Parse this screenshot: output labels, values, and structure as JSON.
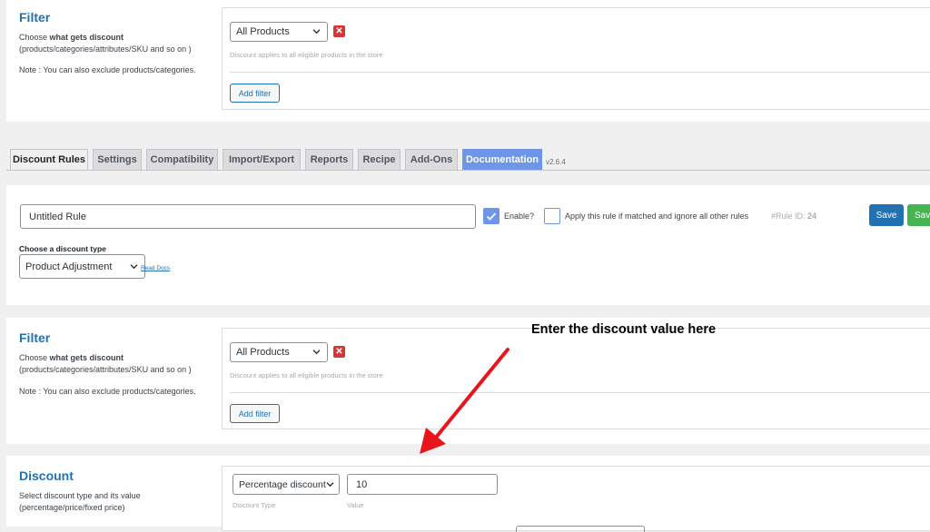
{
  "filter_top": {
    "title": "Filter",
    "desc_prefix": "Choose ",
    "desc_bold": "what gets discount",
    "desc_line2": "(products/categories/attributes/SKU and so on )",
    "note": "Note : You can also exclude products/categories.",
    "select_value": "All Products",
    "hint": "Discount applies to all eligible products in the store",
    "add_filter": "Add filter"
  },
  "tabs": [
    {
      "label": "Discount Rules"
    },
    {
      "label": "Settings"
    },
    {
      "label": "Compatibility"
    },
    {
      "label": "Import/Export"
    },
    {
      "label": "Reports"
    },
    {
      "label": "Recipe"
    },
    {
      "label": "Add-Ons"
    },
    {
      "label": "Documentation"
    }
  ],
  "version": "v2.6.4",
  "rule": {
    "name_value": "Untitled Rule",
    "enable_label": "Enable?",
    "apply_label": "Apply this rule if matched and ignore all other rules",
    "rule_id_label": "#Rule ID:",
    "rule_id_value": "24",
    "save_label": "Save",
    "save_close_label": "Sav",
    "discount_type_label": "Choose a discount type",
    "discount_type_value": "Product Adjustment",
    "read_docs": "Read Docs"
  },
  "filter": {
    "title": "Filter",
    "desc_prefix": "Choose ",
    "desc_bold": "what gets discount",
    "desc_line2": "(products/categories/attributes/SKU and so on )",
    "note": "Note : You can also exclude products/categories.",
    "select_value": "All Products",
    "hint": "Discount applies to all eligible products in the store",
    "add_filter": "Add filter"
  },
  "annotation": {
    "text": "Enter the discount value here",
    "color": "#e8161b"
  },
  "discount": {
    "title": "Discount",
    "desc_line1": "Select discount type and its value",
    "desc_line2": "(percentage/price/fixed price)",
    "type_value": "Percentage discount",
    "value": "10",
    "type_caption": "Discount Type",
    "value_caption": "Value"
  },
  "colors": {
    "accent": "#2271b1",
    "remove": "#d63638",
    "save": "#2271b1",
    "save_close": "#46b450",
    "doc_tab": "#6f95e8"
  },
  "icons": [
    "chevron-down-icon",
    "close-icon",
    "checkmark-icon",
    "arrow-icon"
  ]
}
